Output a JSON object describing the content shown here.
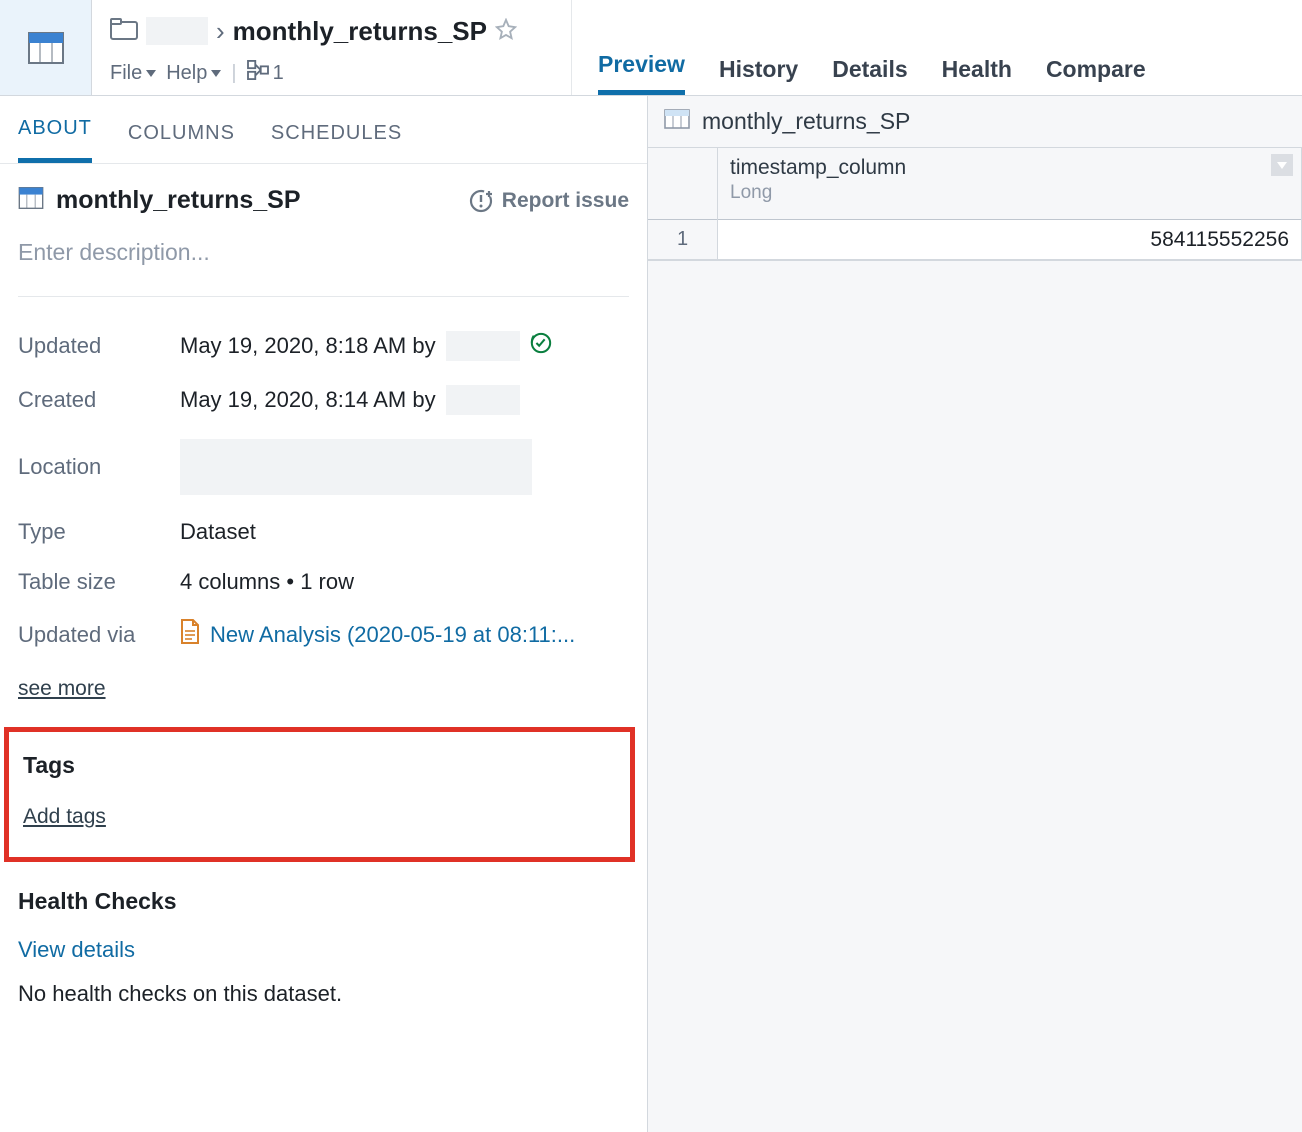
{
  "breadcrumb": {
    "dataset_name": "monthly_returns_SP"
  },
  "menu": {
    "file": "File",
    "help": "Help",
    "branch_count": "1"
  },
  "right_tabs": [
    "Preview",
    "History",
    "Details",
    "Health",
    "Compare"
  ],
  "left_tabs": [
    "ABOUT",
    "COLUMNS",
    "SCHEDULES"
  ],
  "about": {
    "title": "monthly_returns_SP",
    "report_issue": "Report issue",
    "description_placeholder": "Enter description...",
    "meta": {
      "updated_label": "Updated",
      "updated_value": "May 19, 2020, 8:18 AM by",
      "created_label": "Created",
      "created_value": "May 19, 2020, 8:14 AM by",
      "location_label": "Location",
      "type_label": "Type",
      "type_value": "Dataset",
      "tablesize_label": "Table size",
      "tablesize_value": "4 columns • 1 row",
      "updatedvia_label": "Updated via",
      "updatedvia_value": "New Analysis (2020-05-19 at 08:11:..."
    },
    "see_more": "see more",
    "tags_title": "Tags",
    "add_tags": "Add tags",
    "hc_title": "Health Checks",
    "view_details": "View details",
    "hc_empty": "No health checks on this dataset."
  },
  "preview": {
    "title": "monthly_returns_SP",
    "column": {
      "name": "timestamp_column",
      "type": "Long"
    },
    "rows": [
      {
        "index": "1",
        "value": "584115552256"
      }
    ]
  }
}
